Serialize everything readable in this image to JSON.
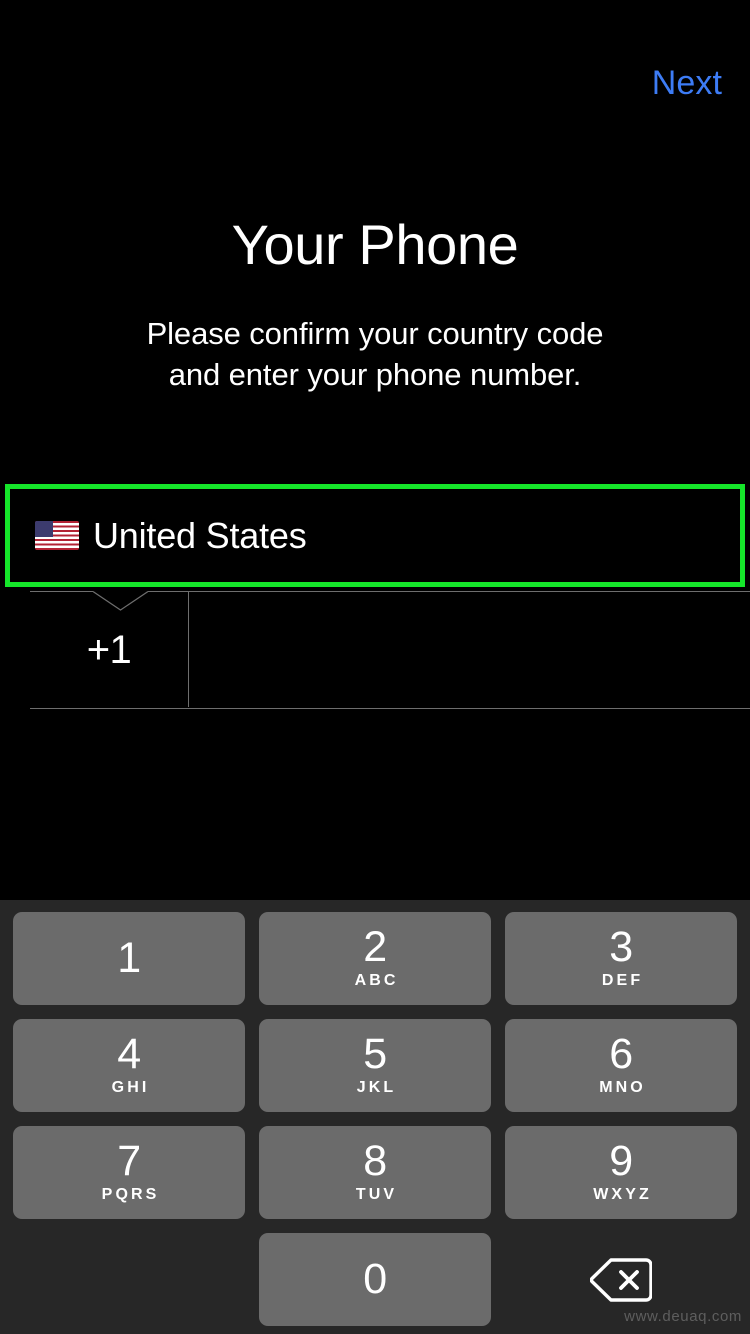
{
  "header": {
    "next_label": "Next"
  },
  "content": {
    "title": "Your Phone",
    "subtitle_line1": "Please confirm your country code",
    "subtitle_line2": "and enter your phone number."
  },
  "country_selector": {
    "flag": "🇺🇸",
    "country_name": "United States",
    "highlight_color": "#15e62a",
    "highlighted": "true"
  },
  "phone_entry": {
    "country_code": "+1",
    "phone_number": "",
    "phone_placeholder": ""
  },
  "keypad": {
    "keys": [
      {
        "digit": "1",
        "letters": ""
      },
      {
        "digit": "2",
        "letters": "ABC"
      },
      {
        "digit": "3",
        "letters": "DEF"
      },
      {
        "digit": "4",
        "letters": "GHI"
      },
      {
        "digit": "5",
        "letters": "JKL"
      },
      {
        "digit": "6",
        "letters": "MNO"
      },
      {
        "digit": "7",
        "letters": "PQRS"
      },
      {
        "digit": "8",
        "letters": "TUV"
      },
      {
        "digit": "9",
        "letters": "WXYZ"
      },
      {
        "digit": "0",
        "letters": ""
      }
    ],
    "backspace_icon": "delete-left-icon",
    "key_color": "#6b6b6b",
    "panel_color": "#272727"
  },
  "watermark": {
    "text": "www.deuaq.com"
  },
  "theme": {
    "background": "#000000",
    "accent_blue": "#3d7cf5",
    "text_primary": "#ffffff",
    "separator": "#6e6e6e"
  }
}
